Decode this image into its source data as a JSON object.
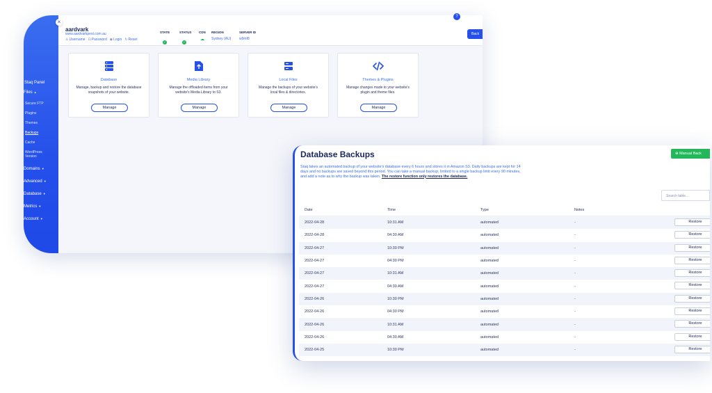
{
  "panel": {
    "sidebar": {
      "items": [
        {
          "label": "Staq Panel",
          "caret": ""
        },
        {
          "label": "Files",
          "caret": "▲"
        },
        {
          "label": "Secure FTP",
          "caret": ""
        },
        {
          "label": "Plugins",
          "caret": ""
        },
        {
          "label": "Themes",
          "caret": ""
        },
        {
          "label": "Backups",
          "caret": ""
        },
        {
          "label": "Cache",
          "caret": ""
        },
        {
          "label": "WordPress Version",
          "caret": ""
        },
        {
          "label": "Domains",
          "caret": "▼"
        },
        {
          "label": "Advanced",
          "caret": "▼"
        },
        {
          "label": "Database",
          "caret": "▼"
        },
        {
          "label": "Metrics",
          "caret": "▼"
        },
        {
          "label": "Account",
          "caret": "▼"
        }
      ]
    },
    "site": {
      "name": "aardvark",
      "url": "www.aardvarkpest.com.au",
      "links": [
        "Username",
        "Password",
        "Login",
        "Reset"
      ]
    },
    "stats": {
      "state_label": "STATE",
      "status_label": "STATUS",
      "cdn_label": "CDN",
      "region_label": "REGION",
      "region_value": "Sydney (AU)",
      "server_label": "SERVER ID",
      "server_value": "w9mf8"
    },
    "back_button": "Back",
    "help": "?",
    "cards": [
      {
        "title": "Database",
        "desc": "Manage, backup and restore the database snapshots of your website.",
        "button": "Manage",
        "icon": "database-icon"
      },
      {
        "title": "Media Library",
        "desc": "Manage the offloaded items from your website's Media Library to S3.",
        "button": "Manage",
        "icon": "upload-file-icon"
      },
      {
        "title": "Local Files",
        "desc": "Manage the backups of your website's local files & directories.",
        "button": "Manage",
        "icon": "server-icon"
      },
      {
        "title": "Themes & Plugins",
        "desc": "Manage changes made to your website's plugin and theme files.",
        "button": "Manage",
        "icon": "code-icon"
      }
    ]
  },
  "backups": {
    "title": "Database Backups",
    "manual_button": "Manual Back",
    "description": "Staq takes an automated backup of your website's database every 6 hours and stores it in Amazon S3. Daily backups are kept for 14 days and no backups are saved beyond this period. You can take a manual backup, limited to a single backup limit every 90 minutes, and add a note as to why the backup was taken.",
    "description_bold": "The restore function only restores the database.",
    "search_placeholder": "Search table...",
    "columns": [
      "Date",
      "Time",
      "Type",
      "Notes"
    ],
    "restore_label": "Restore",
    "rows": [
      {
        "date": "2022-04-28",
        "time": "10:31 AM",
        "type": "automated",
        "notes": "-"
      },
      {
        "date": "2022-04-28",
        "time": "04:30 AM",
        "type": "automated",
        "notes": "-"
      },
      {
        "date": "2022-04-27",
        "time": "10:30 PM",
        "type": "automated",
        "notes": "-"
      },
      {
        "date": "2022-04-27",
        "time": "04:30 PM",
        "type": "automated",
        "notes": "-"
      },
      {
        "date": "2022-04-27",
        "time": "10:31 AM",
        "type": "automated",
        "notes": "-"
      },
      {
        "date": "2022-04-27",
        "time": "04:30 AM",
        "type": "automated",
        "notes": "-"
      },
      {
        "date": "2022-04-26",
        "time": "10:30 PM",
        "type": "automated",
        "notes": "-"
      },
      {
        "date": "2022-04-26",
        "time": "04:30 PM",
        "type": "automated",
        "notes": "-"
      },
      {
        "date": "2022-04-26",
        "time": "10:31 AM",
        "type": "automated",
        "notes": "-"
      },
      {
        "date": "2022-04-26",
        "time": "04:30 AM",
        "type": "automated",
        "notes": "-"
      },
      {
        "date": "2022-04-25",
        "time": "10:30 PM",
        "type": "automated",
        "notes": "-"
      }
    ]
  },
  "colors": {
    "accent": "#2650ea",
    "success": "#22b85a",
    "text": "#1a2658"
  }
}
